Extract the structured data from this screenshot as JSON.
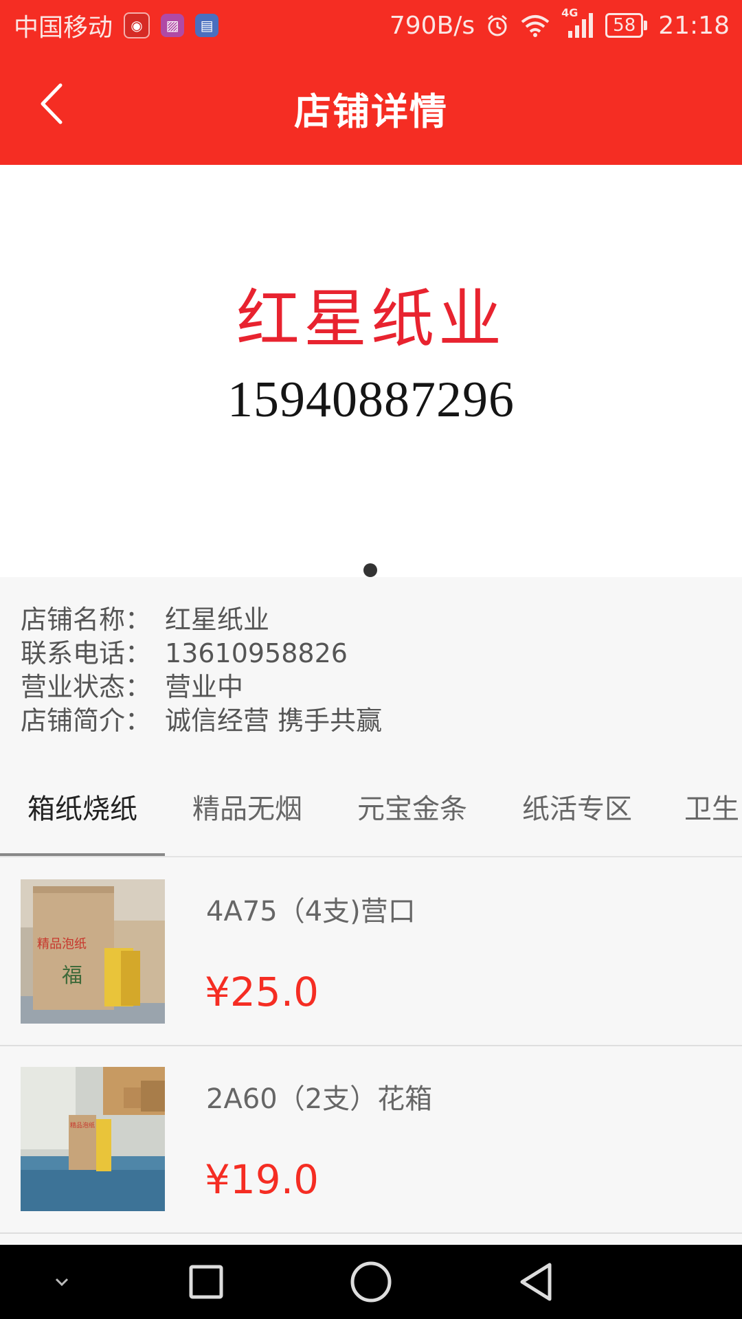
{
  "status_bar": {
    "carrier": "中国移动",
    "speed": "790B/s",
    "network": "4G",
    "battery": "58",
    "time": "21:18",
    "icons": [
      "netease-music-icon",
      "gallery-icon",
      "file-icon",
      "alarm-icon",
      "wifi-icon",
      "signal-icon",
      "battery-icon"
    ]
  },
  "header": {
    "title": "店铺详情",
    "back_icon": "chevron-left-icon"
  },
  "banner": {
    "shop_name": "红星纸业",
    "phone": "15940887296"
  },
  "shop_info": [
    {
      "key": "店铺名称：",
      "value": "红星纸业"
    },
    {
      "key": "联系电话：",
      "value": "13610958826"
    },
    {
      "key": "营业状态：",
      "value": "营业中"
    },
    {
      "key": "店铺简介：",
      "value": "诚信经营 携手共赢"
    }
  ],
  "tabs": [
    {
      "label": "箱纸烧纸",
      "active": true
    },
    {
      "label": "精品无烟",
      "active": false
    },
    {
      "label": "元宝金条",
      "active": false
    },
    {
      "label": "纸活专区",
      "active": false
    },
    {
      "label": "卫生",
      "active": false
    }
  ],
  "products": [
    {
      "name": "4A75（4支)营口",
      "price": "¥25.0",
      "box_label": "精品泡纸",
      "box_char": "福"
    },
    {
      "name": "2A60（2支）花箱",
      "price": "¥19.0",
      "box_label": "精品泡纸"
    }
  ],
  "colors": {
    "brand_red": "#f52d23",
    "price_red": "#f52d23",
    "banner_red": "#e8232f"
  },
  "nav_bar": {
    "icons": [
      "collapse-chevron-icon",
      "recents-square-icon",
      "home-circle-icon",
      "back-triangle-icon"
    ]
  }
}
